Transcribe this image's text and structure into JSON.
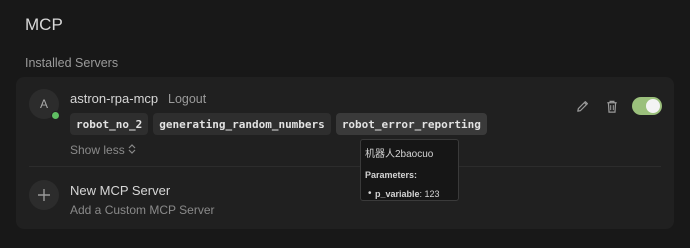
{
  "page": {
    "title": "MCP",
    "section_label": "Installed Servers"
  },
  "server": {
    "avatar_letter": "A",
    "name": "astron-rpa-mcp",
    "logout_label": "Logout",
    "status_color": "#5fbf62",
    "tools": [
      "robot_no_2",
      "generating_random_numbers",
      "robot_error_reporting"
    ],
    "show_less_label": "Show less",
    "enabled": true,
    "toggle_color": "#9bc07c"
  },
  "new_server": {
    "title": "New MCP Server",
    "subtitle": "Add a Custom MCP Server"
  },
  "tooltip": {
    "description": "机器人2baocuo",
    "params_label": "Parameters:",
    "param_name": "p_variable",
    "param_value": "123"
  },
  "icons": {
    "edit": "pencil-icon",
    "delete": "trash-icon",
    "add": "plus-icon",
    "show_less": "chevron-up-down-icon"
  }
}
